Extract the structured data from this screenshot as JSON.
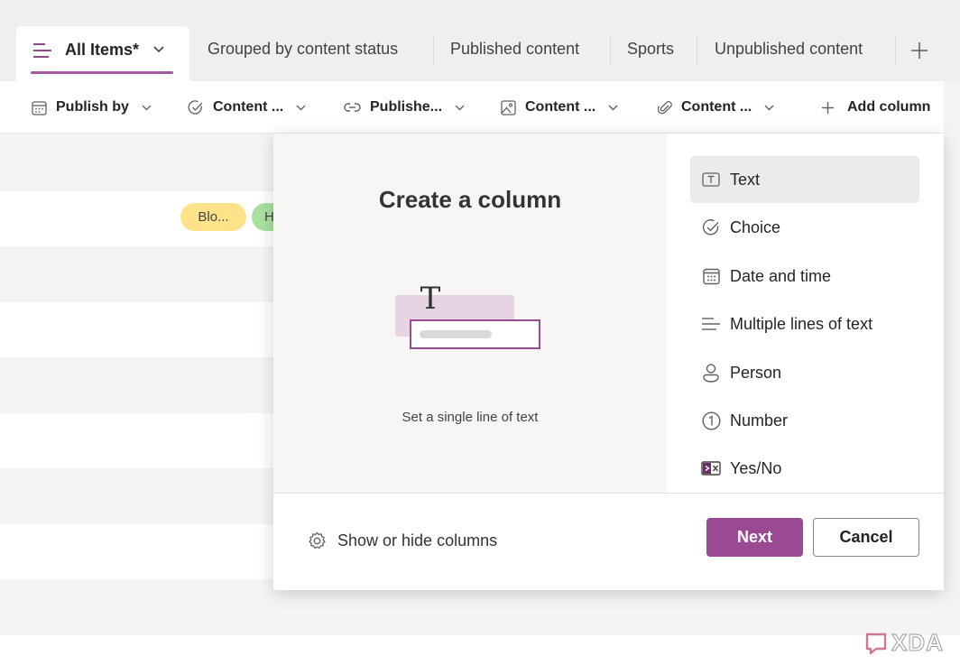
{
  "tabs": {
    "active": {
      "label": "All Items*"
    },
    "items": [
      {
        "label": "Grouped by content status"
      },
      {
        "label": "Published content"
      },
      {
        "label": "Sports"
      },
      {
        "label": "Unpublished content"
      }
    ],
    "add_tab_icon": "plus-icon"
  },
  "columns": [
    {
      "label": "Publish by",
      "icon": "calendar-icon"
    },
    {
      "label": "Content ...",
      "icon": "choice-check-icon"
    },
    {
      "label": "Publishe...",
      "icon": "link-icon"
    },
    {
      "label": "Content ...",
      "icon": "image-icon"
    },
    {
      "label": "Content ...",
      "icon": "attachment-icon"
    }
  ],
  "add_column": {
    "label": "Add column"
  },
  "row_tags": [
    {
      "label": "Blo...",
      "color": "#fce38a"
    },
    {
      "label": "H",
      "color": "#a8e0a0"
    }
  ],
  "panel": {
    "title": "Create a column",
    "description": "Set a single line of text",
    "illustration_glyph": "T",
    "types": [
      {
        "label": "Text",
        "icon": "text-icon",
        "selected": true
      },
      {
        "label": "Choice",
        "icon": "choice-icon"
      },
      {
        "label": "Date and time",
        "icon": "calendar-icon"
      },
      {
        "label": "Multiple lines of text",
        "icon": "multiline-icon"
      },
      {
        "label": "Person",
        "icon": "person-icon"
      },
      {
        "label": "Number",
        "icon": "number-icon"
      },
      {
        "label": "Yes/No",
        "icon": "yes-no-icon"
      }
    ],
    "show_hide_label": "Show or hide columns",
    "next_label": "Next",
    "cancel_label": "Cancel"
  },
  "watermark": {
    "text": "XDA"
  },
  "colors": {
    "accent": "#9a4a93",
    "tab_underline": "#a25aa0",
    "selected_bg": "#edebe9"
  }
}
